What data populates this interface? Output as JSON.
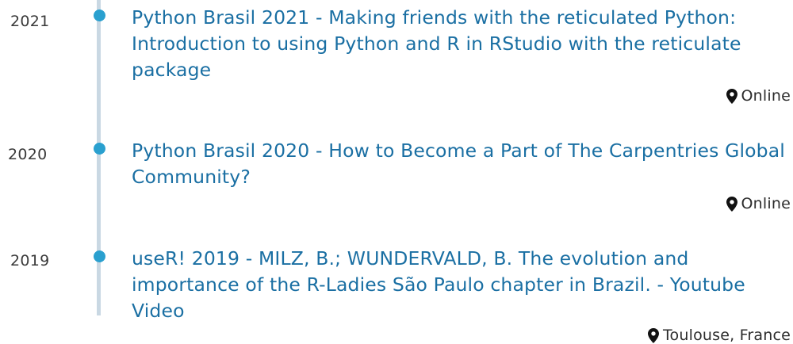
{
  "colors": {
    "accent": "#2aa0cf",
    "link": "#1a6fa3",
    "timeline": "#c9d8e3"
  },
  "location_icon": "map-marker-icon",
  "talks": [
    {
      "year": "2021",
      "title": "Python Brasil 2021 - Making friends with the reticulated Python: Introduction to using Python and R in RStudio with the reticulate package",
      "location": "Online"
    },
    {
      "year": "2020",
      "title": "Python Brasil 2020 - How to Become a Part of The Carpentries Global Community?",
      "location": "Online"
    },
    {
      "year": "2019",
      "title": "useR! 2019 - MILZ, B.; WUNDERVALD, B. The evolution and importance of the R-Ladies São Paulo chapter in Brazil. - Youtube Video",
      "location": "Toulouse, France"
    }
  ]
}
